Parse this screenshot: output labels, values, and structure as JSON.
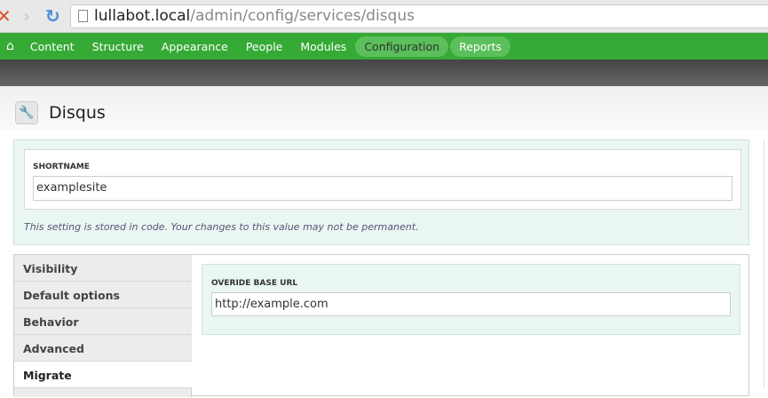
{
  "browser": {
    "url_host": "lullabot.local",
    "url_path": "/admin/config/services/disqus"
  },
  "toolbar": {
    "items": [
      "Content",
      "Structure",
      "Appearance",
      "People",
      "Modules",
      "Configuration",
      "Reports"
    ],
    "active": "Configuration"
  },
  "page": {
    "title": "Disqus"
  },
  "shortname": {
    "label": "SHORTNAME",
    "value": "examplesite",
    "note": "This setting is stored in code. Your changes to this value may not be permanent."
  },
  "tabs": [
    "Visibility",
    "Default options",
    "Behavior",
    "Advanced",
    "Migrate"
  ],
  "active_tab": "Migrate",
  "migrate": {
    "label": "OVERIDE BASE URL",
    "value": "http://example.com"
  }
}
